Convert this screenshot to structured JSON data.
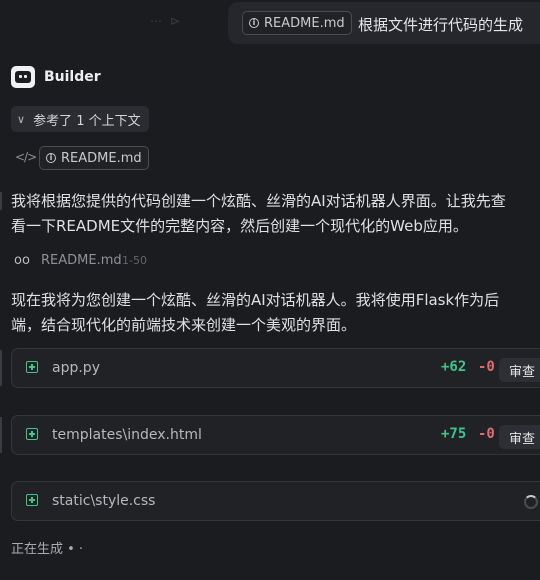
{
  "user_message": {
    "faded_toolbar": "⋯  ⊳",
    "attachment": "README.md",
    "text": "根据文件进行代码的生成"
  },
  "assistant": {
    "name": "Builder",
    "context_toggle": "参考了 1 个上下文",
    "context_file": "README.md",
    "paragraph1_line1": "我将根据您提供的代码创建一个炫酷、丝滑的AI对话机器人界面。让我先查",
    "paragraph1_line2": "看一下README文件的完整内容，然后创建一个现代化的Web应用。",
    "read_file": {
      "name": "README.md",
      "range": "1-50"
    },
    "paragraph2_line1": "现在我将为您创建一个炫酷、丝滑的AI对话机器人。我将使用Flask作为后",
    "paragraph2_line2": "端，结合现代化的前端技术来创建一个美观的界面。",
    "files": [
      {
        "name": "app.py",
        "additions": "+62",
        "deletions": "-0",
        "action": "审查"
      },
      {
        "name": "templates\\index.html",
        "additions": "+75",
        "deletions": "-0",
        "action": "审查"
      },
      {
        "name": "static\\style.css",
        "state": "generating"
      }
    ],
    "status": "正在生成 • ·"
  },
  "colors": {
    "background": "#1b1c20",
    "added": "#3fc48b",
    "removed": "#e06c6c"
  }
}
